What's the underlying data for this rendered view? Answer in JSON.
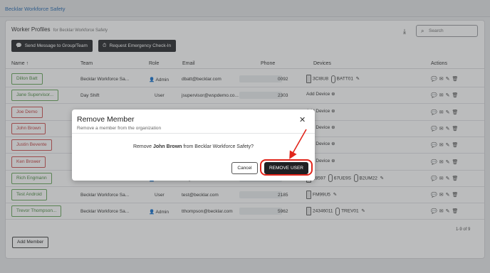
{
  "app": {
    "brand": "Becklar Workforce Safety"
  },
  "card": {
    "title": "Worker Profiles",
    "subtitle": "for Becklar Workforce Safety",
    "search_placeholder": "Search",
    "buttons": {
      "send_message": "Send Message to Group/Team",
      "emergency_checkin": "Request Emergency Check-In"
    }
  },
  "table": {
    "headers": {
      "name": "Name",
      "team": "Team",
      "role": "Role",
      "email": "Email",
      "phone": "Phone",
      "devices": "Devices",
      "actions": "Actions"
    },
    "rows": [
      {
        "name": "Dillon Batt",
        "status": "green",
        "team": "Becklar Workforce Sa...",
        "role": "Admin",
        "email": "dbatt@becklar.com",
        "phone": "0092",
        "devices": [
          "3CI8U8",
          "BATT01"
        ],
        "add_device": ""
      },
      {
        "name": "Jane Supervisor...",
        "status": "green",
        "team": "Day Shift",
        "role": "User",
        "email": "jsupervisor@wspdemo.co...",
        "phone": "2303",
        "devices": [],
        "add_device": "Add Device"
      },
      {
        "name": "Joe Demo",
        "status": "red",
        "team": "",
        "role": "",
        "email": "",
        "phone": "",
        "devices": [],
        "add_device": "Add Device"
      },
      {
        "name": "John Brown",
        "status": "red",
        "team": "",
        "role": "",
        "email": "",
        "phone": "",
        "devices": [],
        "add_device": "Add Device"
      },
      {
        "name": "Justin Bevente",
        "status": "red",
        "team": "",
        "role": "",
        "email": "",
        "phone": "",
        "devices": [],
        "add_device": "Add Device"
      },
      {
        "name": "Ken Brower",
        "status": "red",
        "team": "",
        "role": "",
        "email": "",
        "phone": "",
        "devices": [],
        "add_device": "Add Device"
      },
      {
        "name": "Rich Engmann",
        "status": "green",
        "team": "Becklar Workforce Sa...",
        "role": "Admin",
        "email": "rengmann@becklar.com",
        "phone": "",
        "devices": [
          "28597",
          "67UE9S",
          "B2UM22"
        ],
        "add_device": ""
      },
      {
        "name": "Test Android",
        "status": "green",
        "team": "Becklar Workforce Sa...",
        "role": "User",
        "email": "test@becklar.com",
        "phone": "2185",
        "devices": [
          "FM99U5"
        ],
        "add_device": ""
      },
      {
        "name": "Trevor Thompson...",
        "status": "green",
        "team": "Becklar Workforce Sa...",
        "role": "Admin",
        "email": "tthompson@becklar.com",
        "phone": "5962",
        "devices": [
          "24346011",
          "TREV01"
        ],
        "add_device": ""
      }
    ],
    "count": "1-9 of 9",
    "add_member": "Add Member"
  },
  "modal": {
    "title": "Remove Member",
    "subtitle": "Remove a member from the organization",
    "msg_pre": "Remove ",
    "msg_name": "John Brown",
    "msg_post": " from Becklar Workforce Safety?",
    "cancel": "Cancel",
    "confirm": "REMOVE USER"
  },
  "colors": {
    "accent_blue": "#2d6fb3",
    "status_green": "#4c8b42",
    "status_red": "#c44343",
    "annotation_red": "#e1251b"
  }
}
